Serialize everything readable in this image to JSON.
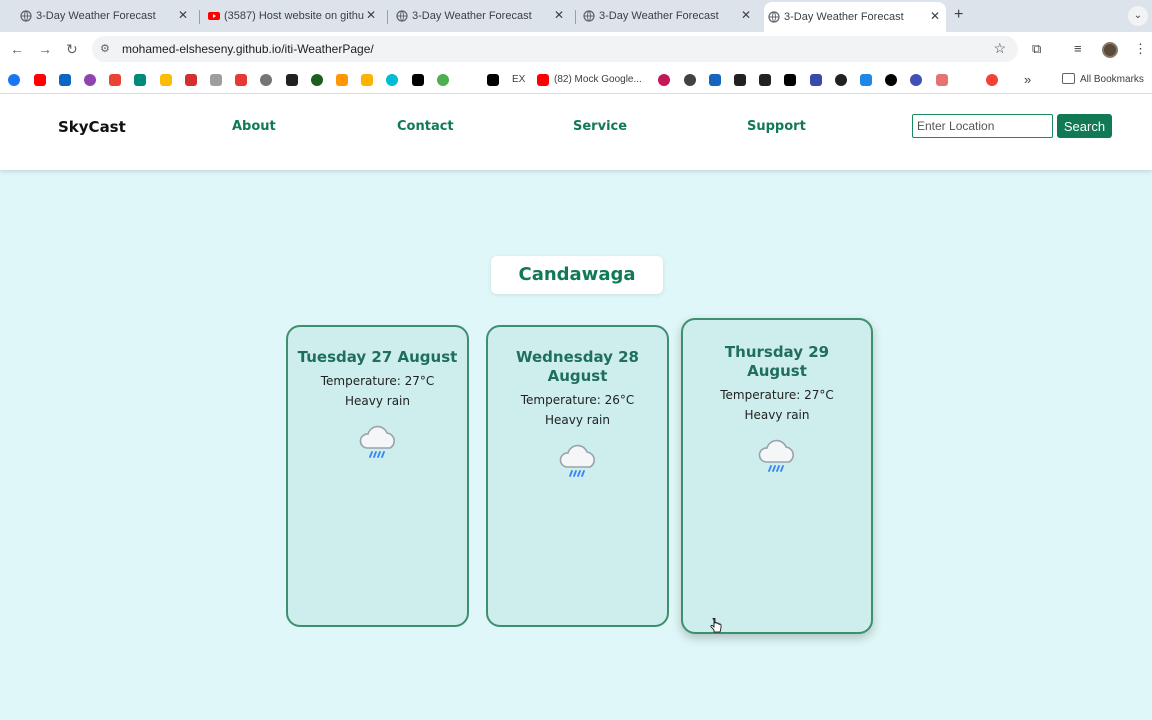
{
  "browser": {
    "tabs": [
      {
        "title": "3-Day Weather Forecast",
        "active": false,
        "favicon": "globe-icon"
      },
      {
        "title": "(3587) Host website on githu",
        "active": false,
        "favicon": "youtube-icon"
      },
      {
        "title": "3-Day Weather Forecast",
        "active": false,
        "favicon": "globe-icon"
      },
      {
        "title": "3-Day Weather Forecast",
        "active": false,
        "favicon": "globe-icon"
      },
      {
        "title": "3-Day Weather Forecast",
        "active": true,
        "favicon": "globe-icon"
      }
    ],
    "url": "mohamed-elsheseny.github.io/iti-WeatherPage/",
    "bookmarks": {
      "mock_google": "(82) Mock Google...",
      "all_bookmarks": "All Bookmarks",
      "ex_label": "EX"
    }
  },
  "page": {
    "logo": "SkyCast",
    "nav": {
      "about": "About",
      "contact": "Contact",
      "service": "Service",
      "support": "Support"
    },
    "search": {
      "placeholder": "Enter Location",
      "button": "Search"
    },
    "location": "Candawaga",
    "forecast": [
      {
        "date": "Tuesday 27 August",
        "temperature": "Temperature: 27°C",
        "condition": "Heavy rain",
        "icon": "heavy-rain-icon"
      },
      {
        "date": "Wednesday 28 August",
        "temperature": "Temperature: 26°C",
        "condition": "Heavy rain",
        "icon": "heavy-rain-icon"
      },
      {
        "date": "Thursday 29 August",
        "temperature": "Temperature: 27°C",
        "condition": "Heavy rain",
        "icon": "heavy-rain-icon"
      }
    ]
  },
  "colors": {
    "accent": "#117a55",
    "page_background": "#dff7f8",
    "card_background": "#cdeeed",
    "card_border": "#3f8f6f"
  }
}
